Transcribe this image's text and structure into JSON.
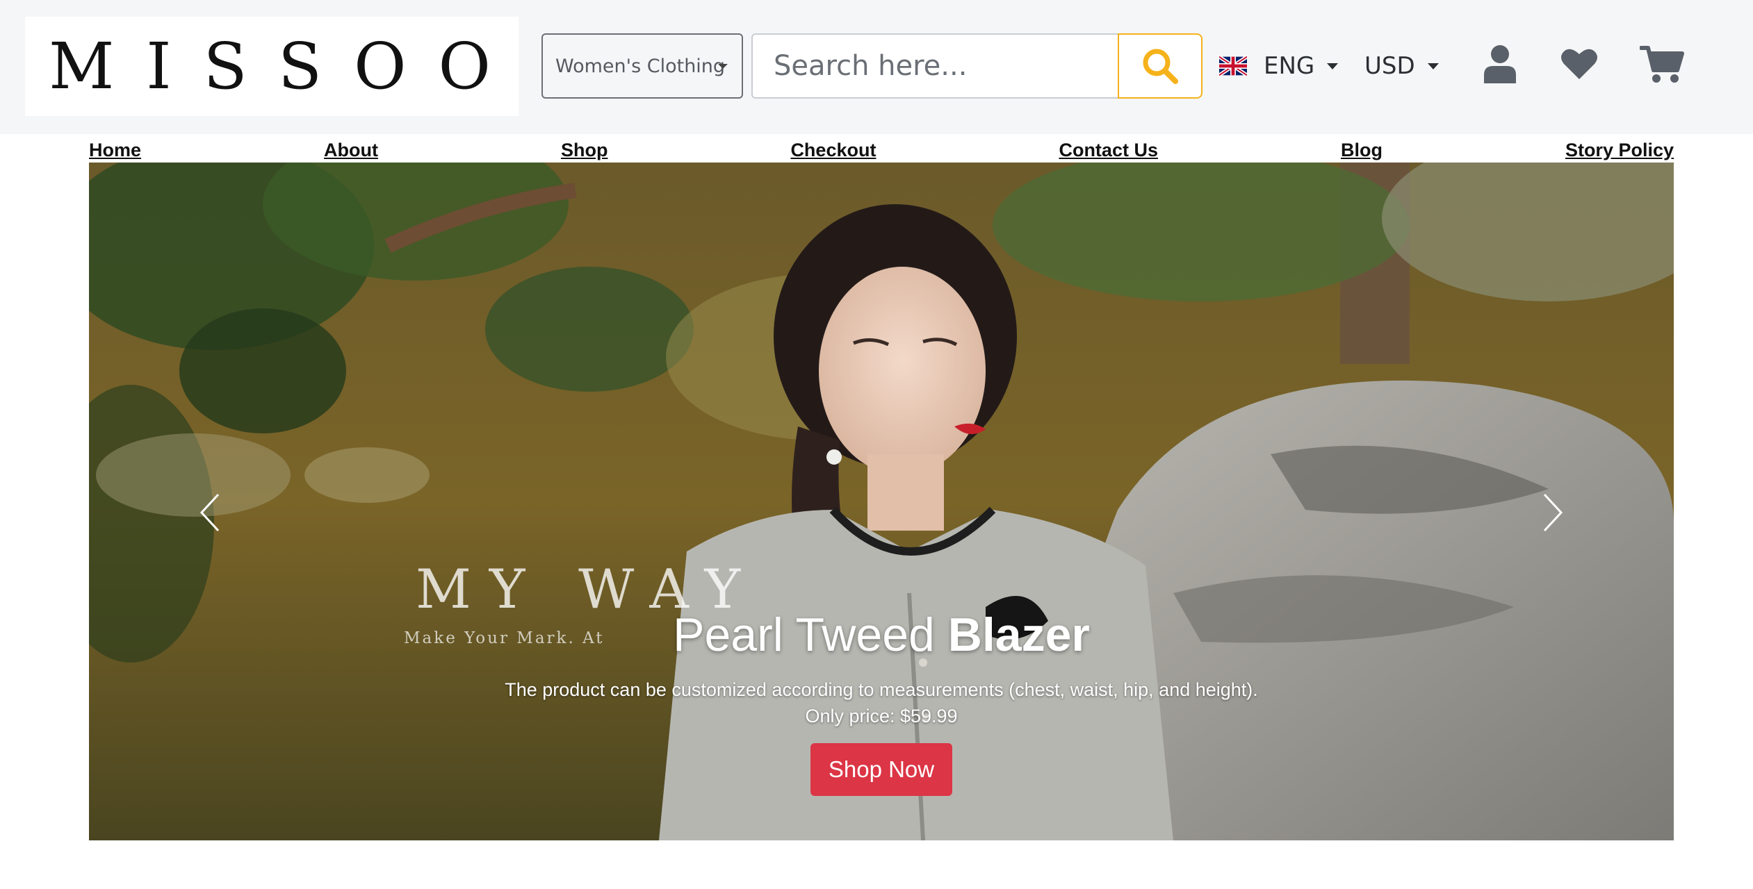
{
  "brand": {
    "logo_text": "MISSOO"
  },
  "search": {
    "category_selected": "Women's Clothing",
    "placeholder": "Search here..."
  },
  "header": {
    "language": "ENG",
    "currency": "USD"
  },
  "nav": {
    "items": [
      {
        "label": "Home"
      },
      {
        "label": "About"
      },
      {
        "label": "Shop"
      },
      {
        "label": "Checkout"
      },
      {
        "label": "Contact Us"
      },
      {
        "label": "Blog"
      },
      {
        "label": "Story Policy"
      }
    ]
  },
  "hero": {
    "title_regular": "Pearl Tweed ",
    "title_bold": "Blazer",
    "description": "The product can be customized according to measurements (chest, waist, hip, and height).",
    "price_line": "Only price: $59.99",
    "button_label": "Shop Now",
    "photo_brand_text": "MY WAY",
    "photo_tagline_text": "Make Your Mark. At"
  },
  "colors": {
    "accent_search": "#f5b21a",
    "cta": "#dc3545",
    "header_bg": "#f5f6f8",
    "icon_gray": "#5a6069"
  }
}
